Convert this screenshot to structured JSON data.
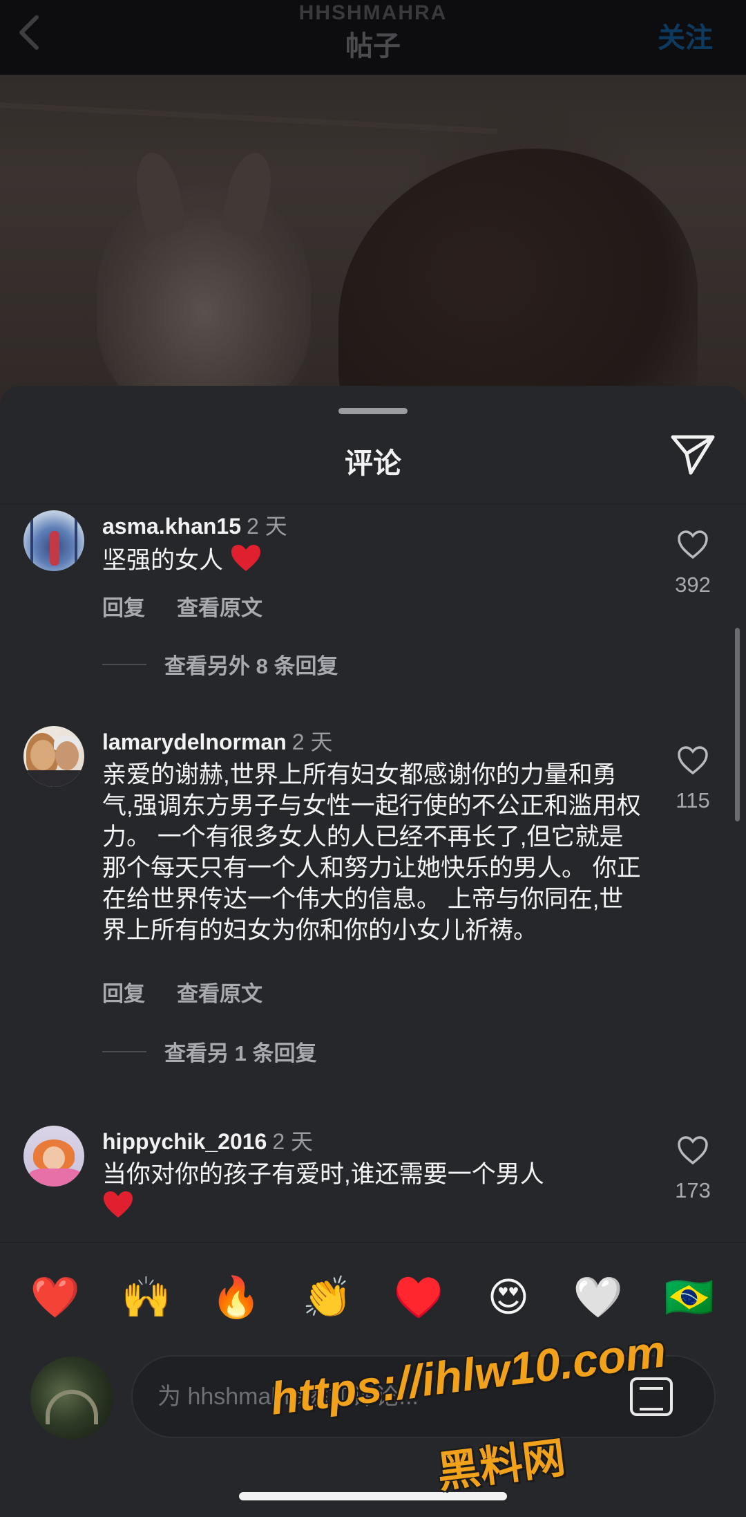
{
  "nav": {
    "username": "HHSHMAHRA",
    "title": "帖子",
    "follow_label": "关注"
  },
  "sheet": {
    "title": "评论"
  },
  "comments": [
    {
      "user": "asma.khan15",
      "time": "2 天",
      "text": "坚强的女人",
      "reply_label": "回复",
      "translate_label": "查看原文",
      "likes": "392",
      "more_replies": "查看另外 8 条回复"
    },
    {
      "user": "lamarydelnorman",
      "time": "2 天",
      "text": "亲爱的谢赫,世界上所有妇女都感谢你的力量和勇气,强调东方男子与女性一起行使的不公正和滥用权力。 一个有很多女人的人已经不再长了,但它就是那个每天只有一个人和努力让她快乐的男人。 你正在给世界传达一个伟大的信息。 上帝与你同在,世界上所有的妇女为你和你的小女儿祈祷。",
      "reply_label": "回复",
      "translate_label": "查看原文",
      "likes": "115",
      "more_replies": "查看另 1 条回复"
    },
    {
      "user": "hippychik_2016",
      "time": "2 天",
      "text": "当你对你的孩子有爱时,谁还需要一个男人",
      "likes": "173"
    }
  ],
  "emoji_bar": [
    "❤️",
    "🙌",
    "🔥",
    "👏",
    "♥️",
    "😍",
    "🤍",
    "🇧🇷"
  ],
  "input": {
    "placeholder": "为 hhshmahra添加评论..."
  },
  "watermark": {
    "url": "https://ihlw10.com",
    "text": "黑料网"
  },
  "colors": {
    "sheet_bg": "#25272b",
    "heart_red": "#e0202e",
    "accent_blue": "#0f3a60"
  }
}
